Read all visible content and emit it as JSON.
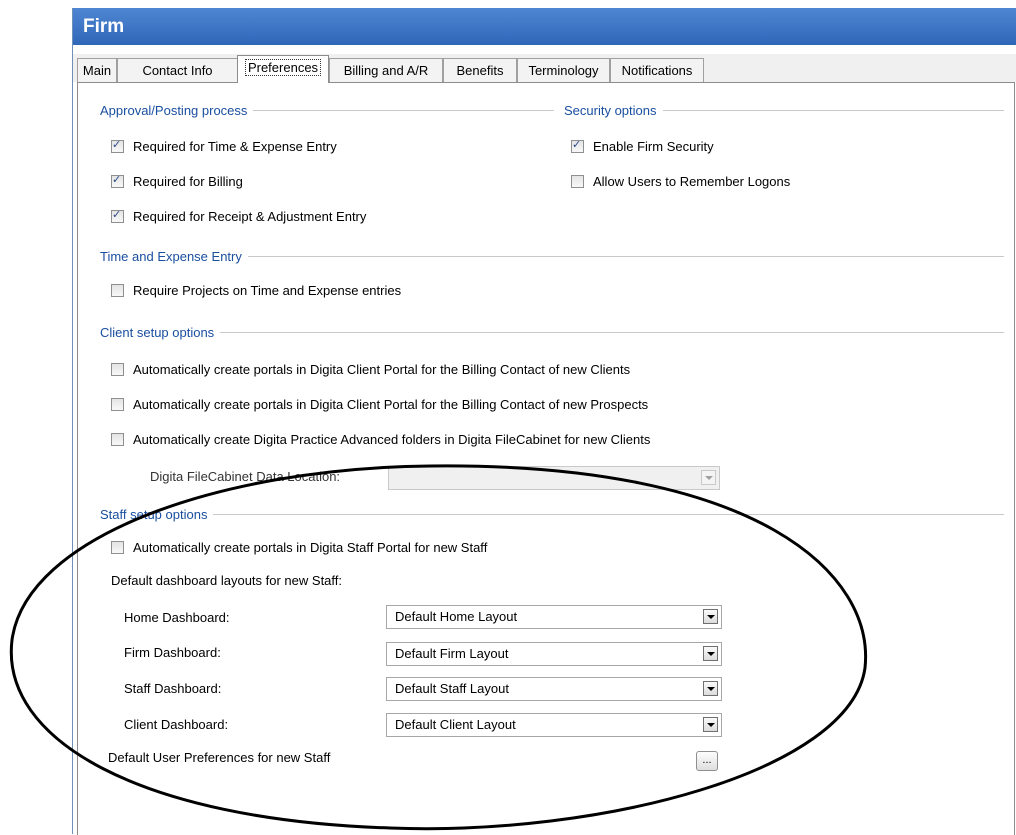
{
  "window": {
    "title": "Firm"
  },
  "tabs": [
    {
      "label": "Main"
    },
    {
      "label": "Contact Info"
    },
    {
      "label": "Preferences"
    },
    {
      "label": "Billing and A/R"
    },
    {
      "label": "Benefits"
    },
    {
      "label": "Terminology"
    },
    {
      "label": "Notifications"
    }
  ],
  "approval": {
    "header": "Approval/Posting process",
    "items": [
      {
        "label": "Required for Time & Expense Entry",
        "checked": true
      },
      {
        "label": "Required for Billing",
        "checked": true
      },
      {
        "label": "Required for Receipt & Adjustment Entry",
        "checked": true
      }
    ]
  },
  "security": {
    "header": "Security options",
    "items": [
      {
        "label": "Enable Firm Security",
        "checked": true
      },
      {
        "label": "Allow Users to Remember Logons",
        "checked": false
      }
    ]
  },
  "time_expense": {
    "header": "Time and Expense Entry",
    "items": [
      {
        "label": "Require Projects on Time and Expense entries",
        "checked": false
      }
    ]
  },
  "client_setup": {
    "header": "Client setup options",
    "items": [
      {
        "label": "Automatically create portals in Digita Client Portal for the Billing Contact of new Clients",
        "checked": false
      },
      {
        "label": "Automatically create portals in Digita Client Portal for the Billing Contact of new Prospects",
        "checked": false
      },
      {
        "label": "Automatically create Digita Practice Advanced folders in Digita FileCabinet for new Clients",
        "checked": false
      }
    ],
    "filecabinet_label": "Digita FileCabinet Data Location:",
    "filecabinet_value": ""
  },
  "staff_setup": {
    "header": "Staff setup options",
    "portal_item": {
      "label": "Automatically create portals in Digita Staff Portal for new Staff",
      "checked": false
    },
    "layouts_label": "Default dashboard layouts for new Staff:",
    "dashboards": [
      {
        "label": "Home Dashboard:",
        "value": "Default Home Layout"
      },
      {
        "label": "Firm Dashboard:",
        "value": "Default Firm Layout"
      },
      {
        "label": "Staff Dashboard:",
        "value": "Default Staff Layout"
      },
      {
        "label": "Client Dashboard:",
        "value": "Default Client Layout"
      }
    ],
    "user_prefs_label": "Default User Preferences for new Staff",
    "user_prefs_button": "..."
  }
}
